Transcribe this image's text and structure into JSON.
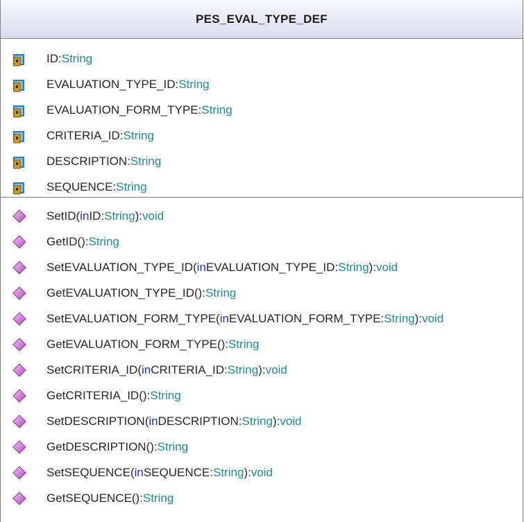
{
  "class_name": "PES_EVAL_TYPE_DEF",
  "attribute_icon": "field-icon",
  "operation_icon": "method-icon",
  "colors": {
    "type": "#1c8c8c",
    "keyword": "#1f2fc4",
    "text": "#262626"
  },
  "attributes": [
    {
      "name": "ID",
      "sep": ":",
      "type": "String"
    },
    {
      "name": "EVALUATION_TYPE_ID",
      "sep": ":",
      "type": "String"
    },
    {
      "name": "EVALUATION_FORM_TYPE",
      "sep": ":",
      "type": "String"
    },
    {
      "name": "CRITERIA_ID",
      "sep": ":",
      "type": "String"
    },
    {
      "name": "DESCRIPTION",
      "sep": ":",
      "type": "String"
    },
    {
      "name": "SEQUENCE",
      "sep": ":",
      "type": "String"
    }
  ],
  "operations": [
    {
      "name": "SetID",
      "open": "(",
      "kw": "in",
      "param": " ID:",
      "ptype": "String",
      "close": "):",
      "ret": "void"
    },
    {
      "name": "GetID",
      "open": "():",
      "kw": "",
      "param": "",
      "ptype": "",
      "close": "",
      "ret": "String"
    },
    {
      "name": "SetEVALUATION_TYPE_ID",
      "open": "(",
      "kw": "in",
      "param": " EVALUATION_TYPE_ID:",
      "ptype": "String",
      "close": "):",
      "ret": "void"
    },
    {
      "name": "GetEVALUATION_TYPE_ID",
      "open": "():",
      "kw": "",
      "param": "",
      "ptype": "",
      "close": "",
      "ret": "String"
    },
    {
      "name": "SetEVALUATION_FORM_TYPE",
      "open": "(",
      "kw": "in",
      "param": " EVALUATION_FORM_TYPE:",
      "ptype": "String",
      "close": "):",
      "ret": "void"
    },
    {
      "name": "GetEVALUATION_FORM_TYPE",
      "open": "():",
      "kw": "",
      "param": "",
      "ptype": "",
      "close": "",
      "ret": "String"
    },
    {
      "name": "SetCRITERIA_ID",
      "open": "(",
      "kw": "in",
      "param": " CRITERIA_ID:",
      "ptype": "String",
      "close": "):",
      "ret": "void"
    },
    {
      "name": "GetCRITERIA_ID",
      "open": "():",
      "kw": "",
      "param": "",
      "ptype": "",
      "close": "",
      "ret": "String"
    },
    {
      "name": "SetDESCRIPTION",
      "open": "(",
      "kw": "in",
      "param": " DESCRIPTION:",
      "ptype": "String",
      "close": "):",
      "ret": "void"
    },
    {
      "name": "GetDESCRIPTION",
      "open": "():",
      "kw": "",
      "param": "",
      "ptype": "",
      "close": "",
      "ret": "String"
    },
    {
      "name": "SetSEQUENCE",
      "open": "(",
      "kw": "in",
      "param": " SEQUENCE:",
      "ptype": "String",
      "close": "):",
      "ret": "void"
    },
    {
      "name": "GetSEQUENCE",
      "open": "():",
      "kw": "",
      "param": "",
      "ptype": "",
      "close": "",
      "ret": "String"
    }
  ]
}
